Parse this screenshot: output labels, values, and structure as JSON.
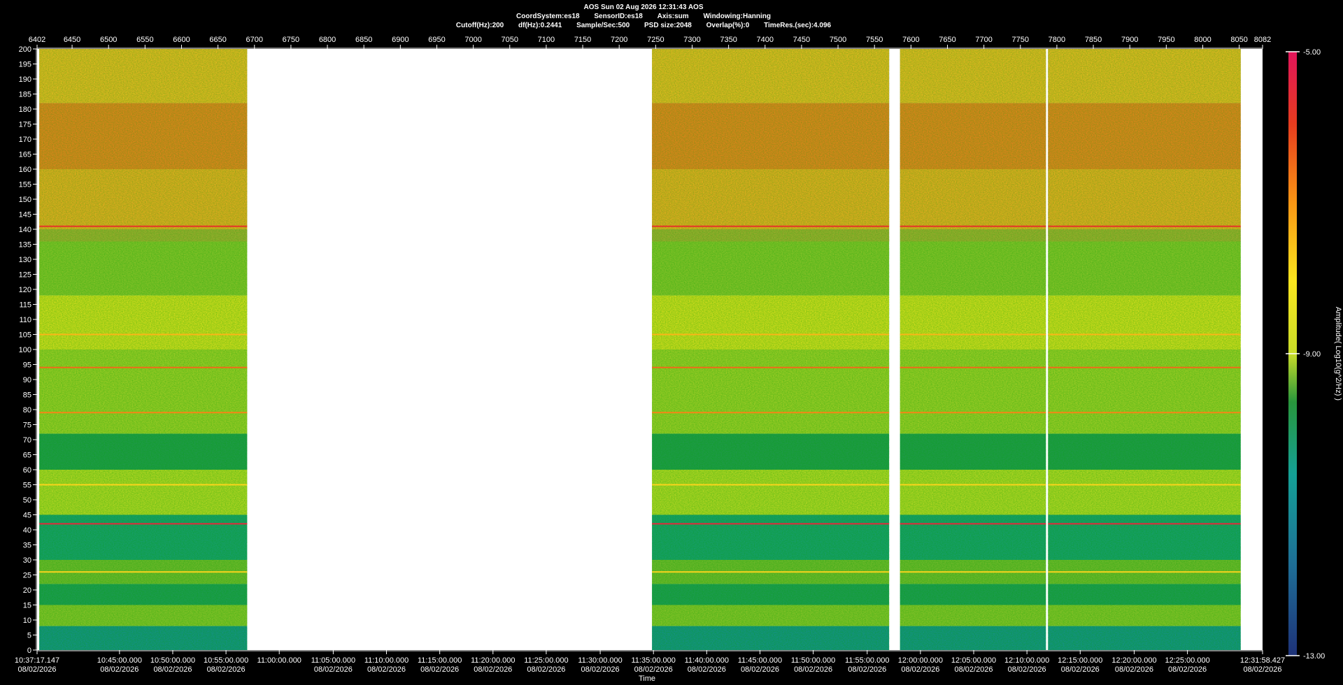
{
  "header": {
    "title": "AOS  Sun 02 Aug 2026 12:31:43  AOS",
    "line2": [
      "CoordSystem:es18",
      "SensorID:es18",
      "Axis:sum",
      "Windowing:Hanning"
    ],
    "line3": [
      "Cutoff(Hz):200",
      "df(Hz):0.2441",
      "Sample/Sec:500",
      "PSD size:2048",
      "Overlap(%):0",
      "TimeRes.(sec):4.096"
    ]
  },
  "chart_data": {
    "type": "heatmap",
    "xlabel": "Time",
    "colorbar_label": "Amplitude( Log10(g^2/Hz) )",
    "colorbar_ticks": [
      "-5.00",
      "-9.00",
      "-13.00"
    ],
    "clim": [
      -13,
      -5
    ],
    "top_axis": {
      "range": [
        6402,
        8082
      ],
      "ticks": [
        "6402",
        "6450",
        "6500",
        "6550",
        "6600",
        "6650",
        "6700",
        "6750",
        "6800",
        "6850",
        "6900",
        "6950",
        "7000",
        "7050",
        "7100",
        "7150",
        "7200",
        "7250",
        "7300",
        "7350",
        "7400",
        "7450",
        "7500",
        "7550",
        "7600",
        "7650",
        "7700",
        "7750",
        "7800",
        "7850",
        "7900",
        "7950",
        "8000",
        "8050",
        "8082"
      ]
    },
    "y_axis": {
      "range": [
        0,
        200
      ],
      "ticks": [
        "0",
        "5",
        "10",
        "15",
        "20",
        "25",
        "30",
        "35",
        "40",
        "45",
        "50",
        "55",
        "60",
        "65",
        "70",
        "75",
        "80",
        "85",
        "90",
        "95",
        "100",
        "105",
        "110",
        "115",
        "120",
        "125",
        "130",
        "135",
        "140",
        "145",
        "150",
        "155",
        "160",
        "165",
        "170",
        "175",
        "180",
        "185",
        "190",
        "195",
        "200"
      ]
    },
    "x_time_labels": [
      {
        "time": "10:37:17.147",
        "date": "08/02/2026",
        "frame": 6402
      },
      {
        "time": "10:45:00.000",
        "date": "08/02/2026",
        "frame": 6515
      },
      {
        "time": "10:50:00.000",
        "date": "08/02/2026",
        "frame": 6588
      },
      {
        "time": "10:55:00.000",
        "date": "08/02/2026",
        "frame": 6661
      },
      {
        "time": "11:00:00.000",
        "date": "",
        "frame": 6734
      },
      {
        "time": "11:05:00.000",
        "date": "08/02/2026",
        "frame": 6808
      },
      {
        "time": "11:10:00.000",
        "date": "08/02/2026",
        "frame": 6881
      },
      {
        "time": "11:15:00.000",
        "date": "08/02/2026",
        "frame": 6954
      },
      {
        "time": "11:20:00.000",
        "date": "08/02/2026",
        "frame": 7027
      },
      {
        "time": "11:25:00.000",
        "date": "08/02/2026",
        "frame": 7100
      },
      {
        "time": "11:30:00.000",
        "date": "08/02/2026",
        "frame": 7174
      },
      {
        "time": "11:35:00.000",
        "date": "08/02/2026",
        "frame": 7247
      },
      {
        "time": "11:40:00.000",
        "date": "08/02/2026",
        "frame": 7320
      },
      {
        "time": "11:45:00.000",
        "date": "08/02/2026",
        "frame": 7393
      },
      {
        "time": "11:50:00.000",
        "date": "08/02/2026",
        "frame": 7466
      },
      {
        "time": "11:55:00.000",
        "date": "08/02/2026",
        "frame": 7540
      },
      {
        "time": "12:00:00.000",
        "date": "08/02/2026",
        "frame": 7613
      },
      {
        "time": "12:05:00.000",
        "date": "08/02/2026",
        "frame": 7686
      },
      {
        "time": "12:10:00.000",
        "date": "08/02/2026",
        "frame": 7759
      },
      {
        "time": "12:15:00.000",
        "date": "08/02/2026",
        "frame": 7832
      },
      {
        "time": "12:20:00.000",
        "date": "08/02/2026",
        "frame": 7906
      },
      {
        "time": "12:25:00.000",
        "date": "08/02/2026",
        "frame": 7979
      },
      {
        "time": "12:31:58.427",
        "date": "08/02/2026",
        "frame": 8082
      }
    ],
    "data_segments": [
      {
        "start": 6405,
        "end": 6690
      },
      {
        "start": 7245,
        "end": 7570
      },
      {
        "start": 7585,
        "end": 7785
      },
      {
        "start": 7788,
        "end": 8052
      }
    ],
    "spectral_bands": [
      {
        "f0": 0,
        "f1": 8,
        "level": -11.0
      },
      {
        "f0": 8,
        "f1": 15,
        "level": -9.2
      },
      {
        "f0": 15,
        "f1": 22,
        "level": -10.0
      },
      {
        "f0": 22,
        "f1": 30,
        "level": -9.3
      },
      {
        "f0": 30,
        "f1": 45,
        "level": -10.3
      },
      {
        "f0": 45,
        "f1": 60,
        "level": -9.0
      },
      {
        "f0": 60,
        "f1": 72,
        "level": -9.9
      },
      {
        "f0": 72,
        "f1": 100,
        "level": -9.1
      },
      {
        "f0": 100,
        "f1": 118,
        "level": -8.3
      },
      {
        "f0": 118,
        "f1": 140,
        "level": -9.2
      },
      {
        "f0": 140,
        "f1": 160,
        "level": -7.6
      },
      {
        "f0": 160,
        "f1": 182,
        "level": -6.9
      },
      {
        "f0": 182,
        "f1": 200,
        "level": -7.8
      }
    ],
    "tonal_lines": [
      {
        "f": 141,
        "level": -5.8
      },
      {
        "f": 94,
        "level": -6.5
      },
      {
        "f": 79,
        "level": -6.8
      },
      {
        "f": 55,
        "level": -7.8
      },
      {
        "f": 42,
        "level": -5.5
      },
      {
        "f": 26,
        "level": -7.8
      },
      {
        "f": 105,
        "level": -7.4
      }
    ]
  }
}
